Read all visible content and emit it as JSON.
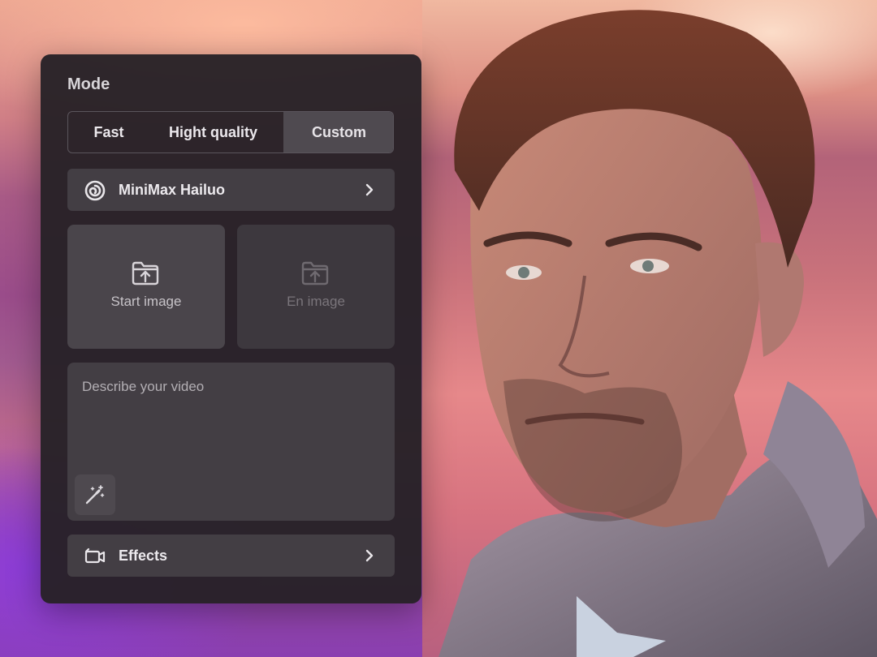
{
  "panel": {
    "title": "Mode",
    "modes": [
      {
        "label": "Fast",
        "selected": false
      },
      {
        "label": "Hight quality",
        "selected": false
      },
      {
        "label": "Custom",
        "selected": true
      }
    ],
    "model": {
      "label": "MiniMax Hailuo",
      "icon": "minimax-logo-icon"
    },
    "uploads": {
      "start_label": "Start image",
      "end_label": "En image",
      "icon": "folder-upload-icon"
    },
    "prompt": {
      "placeholder": "Describe your video",
      "magic_icon": "magic-wand-icon"
    },
    "effects": {
      "label": "Effects",
      "icon": "video-camera-icon"
    }
  },
  "colors": {
    "panel_bg": "#262127",
    "selected_segment": "#4f4a50",
    "row_bg": "#433e44"
  }
}
